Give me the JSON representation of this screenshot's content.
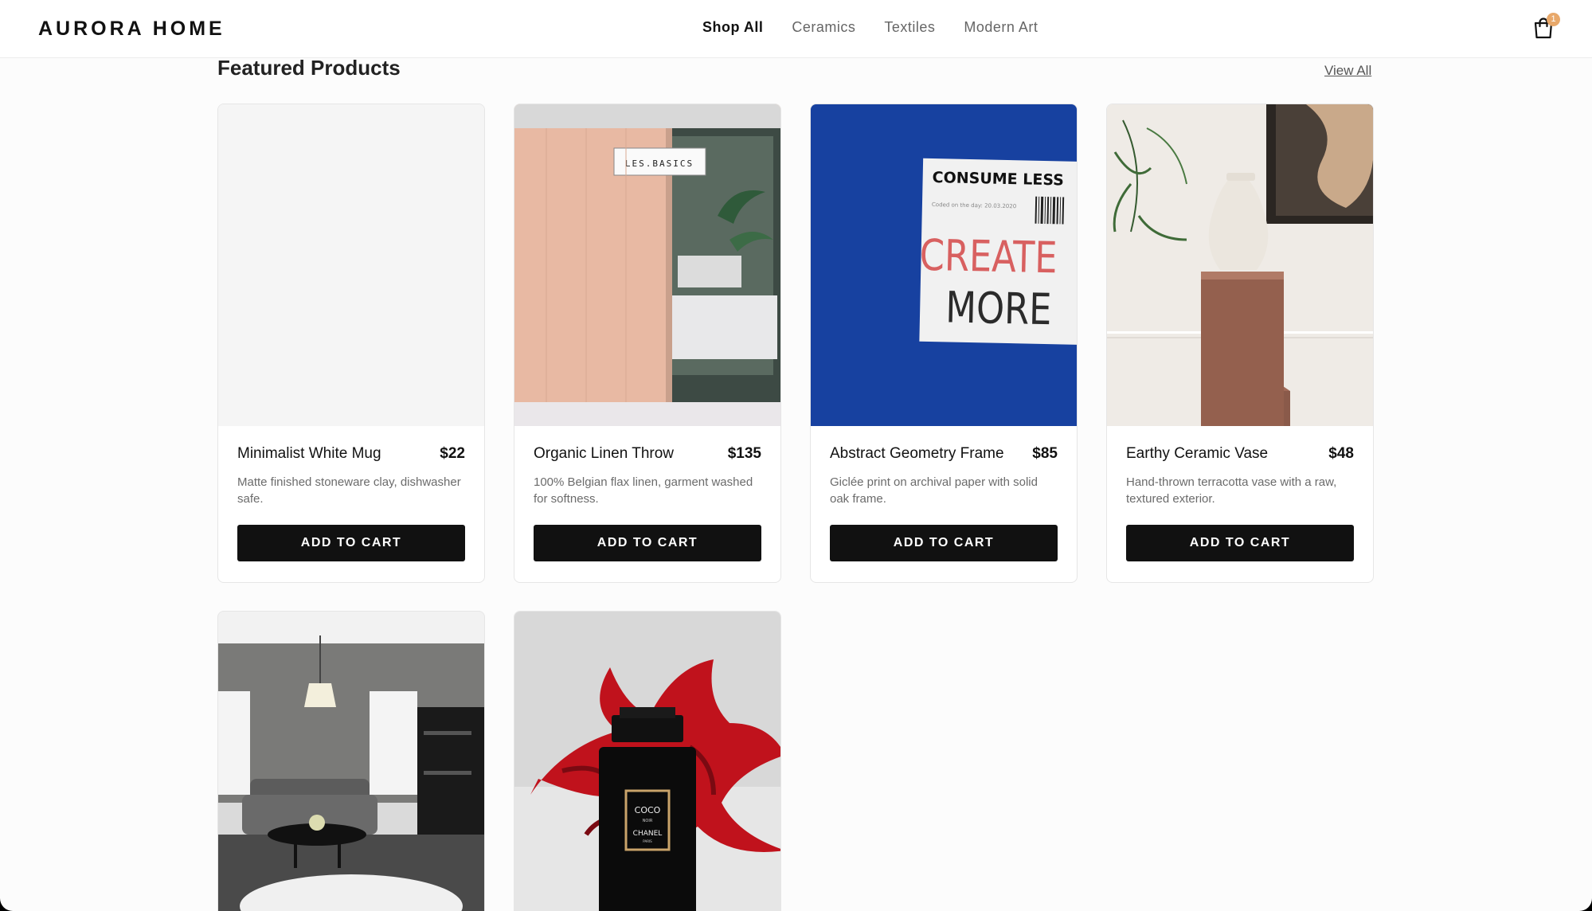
{
  "brand": "AURORA HOME",
  "nav": [
    {
      "label": "Shop All",
      "active": true
    },
    {
      "label": "Ceramics",
      "active": false
    },
    {
      "label": "Textiles",
      "active": false
    },
    {
      "label": "Modern Art",
      "active": false
    }
  ],
  "cart": {
    "icon": "shopping-bag-icon",
    "count": "1"
  },
  "section": {
    "title": "Featured Products",
    "view_all": "View All"
  },
  "products": [
    {
      "name": "Minimalist White Mug",
      "price": "$22",
      "description": "Matte finished stoneware clay, dishwasher safe.",
      "button": "ADD TO CART"
    },
    {
      "name": "Organic Linen Throw",
      "price": "$135",
      "description": "100% Belgian flax linen, garment washed for softness.",
      "button": "ADD TO CART",
      "image_text": "LES.BASICS"
    },
    {
      "name": "Abstract Geometry Frame",
      "price": "$85",
      "description": "Giclée print on archival paper with solid oak frame.",
      "button": "ADD TO CART",
      "image_text": {
        "headline": "CONSUME LESS",
        "small": "Coded on the day: 20.03.2020",
        "word1": "CREATE",
        "word2": "MORE"
      }
    },
    {
      "name": "Earthy Ceramic Vase",
      "price": "$48",
      "description": "Hand-thrown terracotta vase with a raw, textured exterior.",
      "button": "ADD TO CART"
    },
    {
      "name": "",
      "price": "",
      "description": "",
      "button": ""
    },
    {
      "name": "",
      "price": "",
      "description": "",
      "button": "",
      "image_text": {
        "line1": "COCO",
        "line2": "NOIR",
        "line3": "CHANEL",
        "line4": "PARIS"
      }
    }
  ],
  "colors": {
    "accent": "#111111",
    "badge": "#e8a86a",
    "background": "#fcfcfc"
  }
}
